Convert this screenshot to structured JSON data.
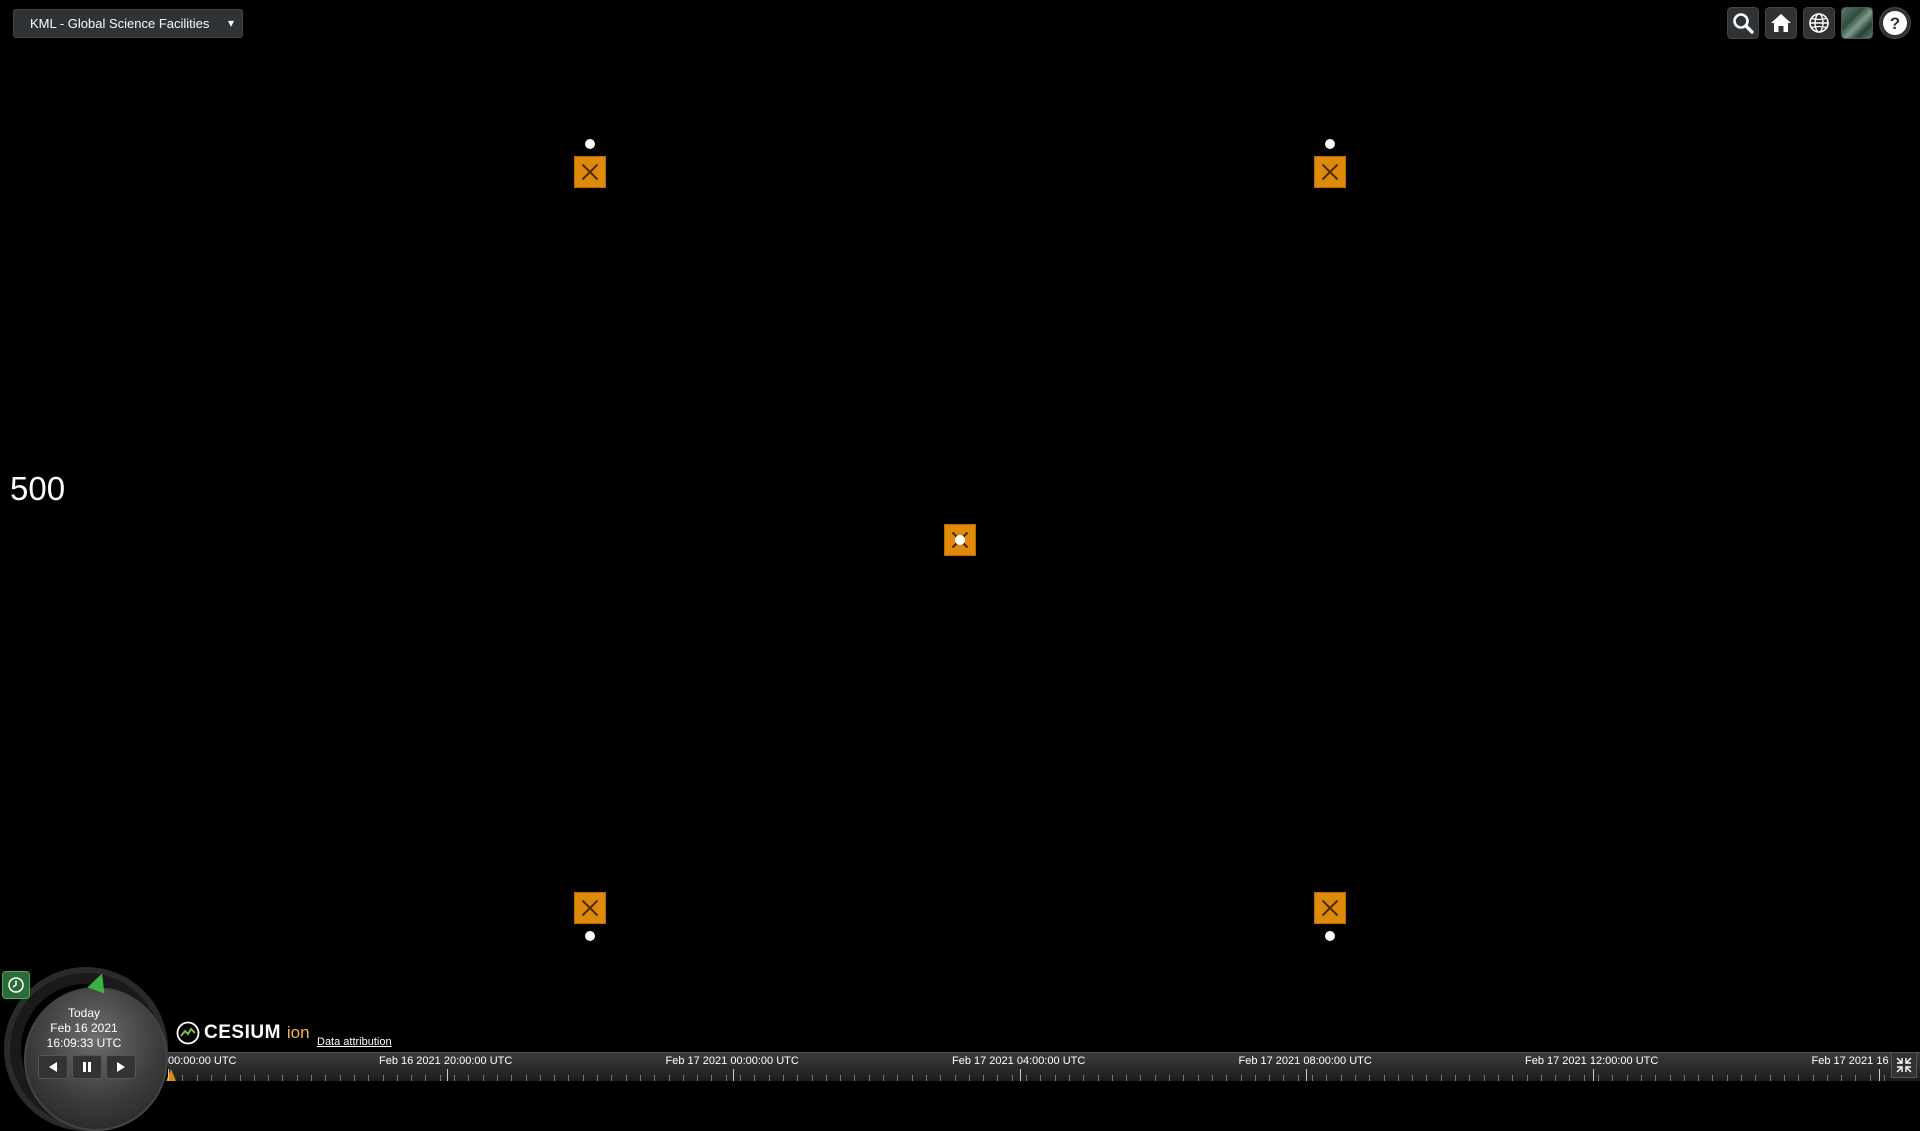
{
  "dataset_select": {
    "selected": "KML - Global Science Facilities"
  },
  "toolbar": {
    "buttons": [
      {
        "name": "geocoder-search",
        "icon": "search-icon"
      },
      {
        "name": "home",
        "icon": "home-icon"
      },
      {
        "name": "scene-mode",
        "icon": "globe-icon"
      },
      {
        "name": "base-layer-picker",
        "icon": "imagery-thumbnail-icon"
      },
      {
        "name": "navigation-help",
        "icon": "help-icon"
      }
    ]
  },
  "side_value": "500",
  "markers": {
    "icon": "facility-marker-icon",
    "color": "#e08a0c"
  },
  "animation": {
    "date_label": "Today",
    "date": "Feb 16 2021",
    "time": "16:09:33 UTC"
  },
  "credits": {
    "logo_word": "CESIUM",
    "logo_suffix": "ion",
    "attribution_link": "Data attribution"
  },
  "timeline": {
    "labels": [
      "00:00:00 UTC",
      "Feb 16 2021 20:00:00 UTC",
      "Feb 17 2021 00:00:00 UTC",
      "Feb 17 2021 04:00:00 UTC",
      "Feb 17 2021 08:00:00 UTC",
      "Feb 17 2021 12:00:00 UTC",
      "Feb 17 2021 16"
    ]
  }
}
